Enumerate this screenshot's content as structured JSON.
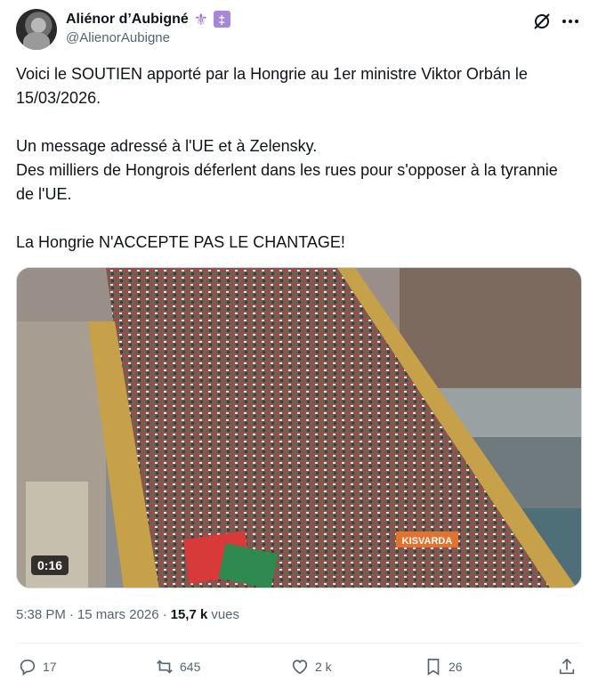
{
  "author": {
    "display_name": "Aliénor d’Aubigné",
    "handle": "@AlienorAubigne",
    "badges": [
      "fleur-de-lis-emoji",
      "cross-of-lorraine-emoji"
    ]
  },
  "tweet": {
    "text": "Voici le SOUTIEN apporté par la Hongrie au 1er ministre Viktor Orbán le 15/03/2026.\n\nUn message adressé à l'UE et à Zelensky.\nDes milliers de Hongrois déferlent dans les rues pour s'opposer à la tyrannie de l'UE.\n\nLa Hongrie N'ACCEPTE PAS LE CHANTAGE!"
  },
  "media": {
    "duration": "0:16",
    "banner_text": "KISVARDA"
  },
  "meta": {
    "time": "5:38 PM",
    "separator": "·",
    "date": "15 mars 2026",
    "views_count": "15,7 k",
    "views_label": "vues"
  },
  "actions": {
    "replies": "17",
    "reposts": "645",
    "likes": "2 k",
    "bookmarks": "26"
  },
  "colors": {
    "text": "#0f1419",
    "secondary": "#536471",
    "border": "#cfd9de",
    "badge_purple": "#a787d8"
  }
}
